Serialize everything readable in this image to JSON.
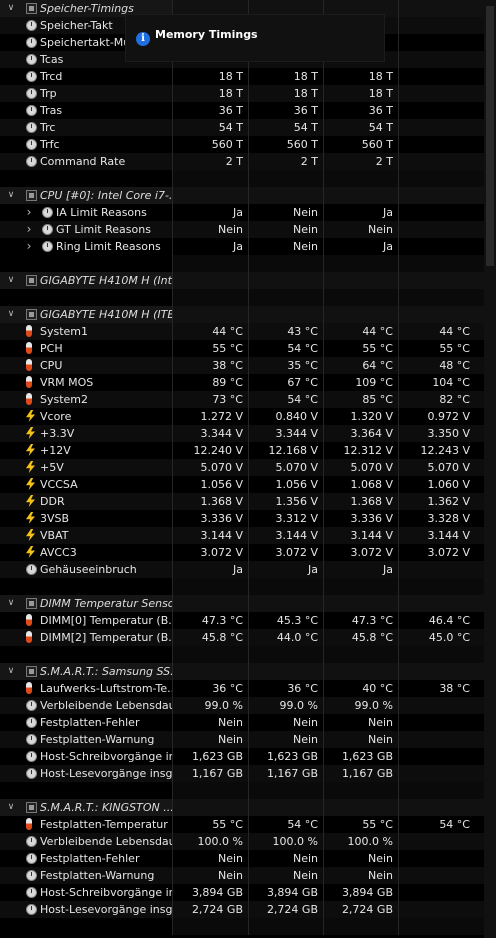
{
  "rows": [
    {
      "type": "group",
      "icon": "chip",
      "label": "Speicher-Timings"
    },
    {
      "type": "item",
      "icon": "clock",
      "label": "Speicher-Takt",
      "values": [
        "",
        "",
        "",
        ""
      ]
    },
    {
      "type": "item",
      "icon": "clock",
      "label": "Speichertakt-Mul",
      "values": [
        "",
        "",
        "",
        ""
      ]
    },
    {
      "type": "item",
      "icon": "clock",
      "label": "Tcas",
      "values": [
        "",
        "",
        "",
        ""
      ]
    },
    {
      "type": "item",
      "icon": "clock",
      "label": "Trcd",
      "values": [
        "18 T",
        "18 T",
        "18 T",
        ""
      ]
    },
    {
      "type": "item",
      "icon": "clock",
      "label": "Trp",
      "values": [
        "18 T",
        "18 T",
        "18 T",
        ""
      ]
    },
    {
      "type": "item",
      "icon": "clock",
      "label": "Tras",
      "values": [
        "36 T",
        "36 T",
        "36 T",
        ""
      ]
    },
    {
      "type": "item",
      "icon": "clock",
      "label": "Trc",
      "values": [
        "54 T",
        "54 T",
        "54 T",
        ""
      ]
    },
    {
      "type": "item",
      "icon": "clock",
      "label": "Trfc",
      "values": [
        "560 T",
        "560 T",
        "560 T",
        ""
      ]
    },
    {
      "type": "item",
      "icon": "clock",
      "label": "Command Rate",
      "values": [
        "2 T",
        "2 T",
        "2 T",
        ""
      ]
    },
    {
      "type": "blank"
    },
    {
      "type": "group",
      "icon": "chip",
      "label": "CPU [#0]: Intel Core i7-..."
    },
    {
      "type": "subitem",
      "icon": "clock",
      "label": "IA Limit Reasons",
      "values": [
        "Ja",
        "Nein",
        "Ja",
        ""
      ]
    },
    {
      "type": "subitem",
      "icon": "clock",
      "label": "GT Limit Reasons",
      "values": [
        "Nein",
        "Nein",
        "Nein",
        ""
      ]
    },
    {
      "type": "subitem",
      "icon": "clock",
      "label": "Ring Limit Reasons",
      "values": [
        "Ja",
        "Nein",
        "Ja",
        ""
      ]
    },
    {
      "type": "blank"
    },
    {
      "type": "group",
      "icon": "chip",
      "label": "GIGABYTE H410M H (Int..."
    },
    {
      "type": "blank"
    },
    {
      "type": "group",
      "icon": "chip",
      "label": "GIGABYTE H410M H (ITE..."
    },
    {
      "type": "item",
      "icon": "thermo",
      "label": "System1",
      "values": [
        "44 °C",
        "43 °C",
        "44 °C",
        "44 °C"
      ]
    },
    {
      "type": "item",
      "icon": "thermo",
      "label": "PCH",
      "values": [
        "55 °C",
        "54 °C",
        "55 °C",
        "55 °C"
      ]
    },
    {
      "type": "item",
      "icon": "thermo",
      "label": "CPU",
      "values": [
        "38 °C",
        "35 °C",
        "64 °C",
        "48 °C"
      ]
    },
    {
      "type": "item",
      "icon": "thermo",
      "label": "VRM MOS",
      "values": [
        "89 °C",
        "67 °C",
        "109 °C",
        "104 °C"
      ]
    },
    {
      "type": "item",
      "icon": "thermo",
      "label": "System2",
      "values": [
        "73 °C",
        "54 °C",
        "85 °C",
        "82 °C"
      ]
    },
    {
      "type": "item",
      "icon": "volt",
      "label": "Vcore",
      "values": [
        "1.272 V",
        "0.840 V",
        "1.320 V",
        "0.972 V"
      ]
    },
    {
      "type": "item",
      "icon": "volt",
      "label": "+3.3V",
      "values": [
        "3.344 V",
        "3.344 V",
        "3.364 V",
        "3.350 V"
      ]
    },
    {
      "type": "item",
      "icon": "volt",
      "label": "+12V",
      "values": [
        "12.240 V",
        "12.168 V",
        "12.312 V",
        "12.243 V"
      ]
    },
    {
      "type": "item",
      "icon": "volt",
      "label": "+5V",
      "values": [
        "5.070 V",
        "5.070 V",
        "5.070 V",
        "5.070 V"
      ]
    },
    {
      "type": "item",
      "icon": "volt",
      "label": "VCCSA",
      "values": [
        "1.056 V",
        "1.056 V",
        "1.068 V",
        "1.060 V"
      ]
    },
    {
      "type": "item",
      "icon": "volt",
      "label": "DDR",
      "values": [
        "1.368 V",
        "1.356 V",
        "1.368 V",
        "1.362 V"
      ]
    },
    {
      "type": "item",
      "icon": "volt",
      "label": "3VSB",
      "values": [
        "3.336 V",
        "3.312 V",
        "3.336 V",
        "3.328 V"
      ]
    },
    {
      "type": "item",
      "icon": "volt",
      "label": "VBAT",
      "values": [
        "3.144 V",
        "3.144 V",
        "3.144 V",
        "3.144 V"
      ]
    },
    {
      "type": "item",
      "icon": "volt",
      "label": "AVCC3",
      "values": [
        "3.072 V",
        "3.072 V",
        "3.072 V",
        "3.072 V"
      ]
    },
    {
      "type": "item",
      "icon": "clock",
      "label": "Gehäuseeinbruch",
      "values": [
        "Ja",
        "Ja",
        "Ja",
        ""
      ]
    },
    {
      "type": "blank"
    },
    {
      "type": "group",
      "icon": "chip",
      "label": "DIMM Temperatur Sensor"
    },
    {
      "type": "item",
      "icon": "thermo",
      "label": "DIMM[0] Temperatur (B...",
      "values": [
        "47.3 °C",
        "45.3 °C",
        "47.3 °C",
        "46.4 °C"
      ]
    },
    {
      "type": "item",
      "icon": "thermo",
      "label": "DIMM[2] Temperatur (B...",
      "values": [
        "45.8 °C",
        "44.0 °C",
        "45.8 °C",
        "45.0 °C"
      ]
    },
    {
      "type": "blank"
    },
    {
      "type": "group",
      "icon": "chip",
      "label": "S.M.A.R.T.: Samsung SS..."
    },
    {
      "type": "item",
      "icon": "thermo",
      "label": "Laufwerks-Luftstrom-Te...",
      "values": [
        "36 °C",
        "36 °C",
        "40 °C",
        "38 °C"
      ]
    },
    {
      "type": "item",
      "icon": "clock",
      "label": "Verbleibende Lebensdau...",
      "values": [
        "99.0 %",
        "99.0 %",
        "99.0 %",
        ""
      ]
    },
    {
      "type": "item",
      "icon": "clock",
      "label": "Festplatten-Fehler",
      "values": [
        "Nein",
        "Nein",
        "Nein",
        ""
      ]
    },
    {
      "type": "item",
      "icon": "clock",
      "label": "Festplatten-Warnung",
      "values": [
        "Nein",
        "Nein",
        "Nein",
        ""
      ]
    },
    {
      "type": "item",
      "icon": "clock",
      "label": "Host-Schreibvorgänge in...",
      "values": [
        "1,623 GB",
        "1,623 GB",
        "1,623 GB",
        ""
      ]
    },
    {
      "type": "item",
      "icon": "clock",
      "label": "Host-Lesevorgänge insg...",
      "values": [
        "1,167 GB",
        "1,167 GB",
        "1,167 GB",
        ""
      ]
    },
    {
      "type": "blank"
    },
    {
      "type": "group",
      "icon": "chip",
      "label": "S.M.A.R.T.: KINGSTON ..."
    },
    {
      "type": "item",
      "icon": "thermo",
      "label": "Festplatten-Temperatur",
      "values": [
        "55 °C",
        "54 °C",
        "55 °C",
        "54 °C"
      ]
    },
    {
      "type": "item",
      "icon": "clock",
      "label": "Verbleibende Lebensdau...",
      "values": [
        "100.0 %",
        "100.0 %",
        "100.0 %",
        ""
      ]
    },
    {
      "type": "item",
      "icon": "clock",
      "label": "Festplatten-Fehler",
      "values": [
        "Nein",
        "Nein",
        "Nein",
        ""
      ]
    },
    {
      "type": "item",
      "icon": "clock",
      "label": "Festplatten-Warnung",
      "values": [
        "Nein",
        "Nein",
        "Nein",
        ""
      ]
    },
    {
      "type": "item",
      "icon": "clock",
      "label": "Host-Schreibvorgänge in...",
      "values": [
        "3,894 GB",
        "3,894 GB",
        "3,894 GB",
        ""
      ]
    },
    {
      "type": "item",
      "icon": "clock",
      "label": "Host-Lesevorgänge insg...",
      "values": [
        "2,724 GB",
        "2,724 GB",
        "2,724 GB",
        ""
      ]
    },
    {
      "type": "blank"
    }
  ],
  "tooltip": {
    "title": "Memory Timings",
    "icon": "info-icon"
  }
}
